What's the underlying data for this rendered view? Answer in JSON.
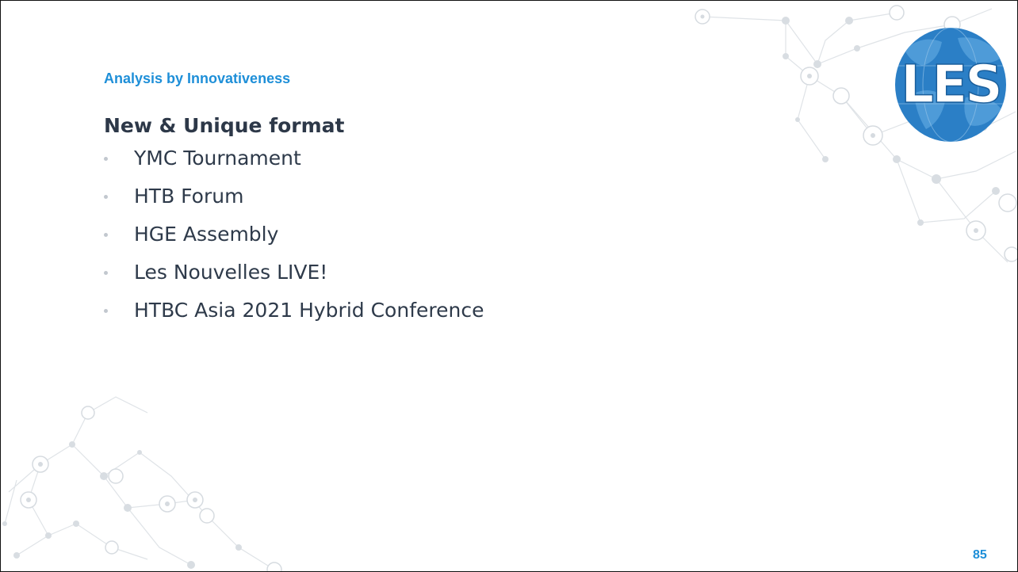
{
  "slide": {
    "section_label": "Analysis by Innovativeness",
    "heading": "New & Unique format",
    "bullets": [
      "YMC Tournament",
      "HTB Forum",
      "HGE Assembly",
      "Les Nouvelles LIVE!",
      "HTBC Asia 2021 Hybrid Conference"
    ],
    "page_number": "85"
  },
  "logo": {
    "text": "LES"
  },
  "colors": {
    "accent": "#1e8fd8",
    "heading": "#2d3848",
    "body_text": "#2e3a4a",
    "bullet": "#c2c8cf"
  }
}
